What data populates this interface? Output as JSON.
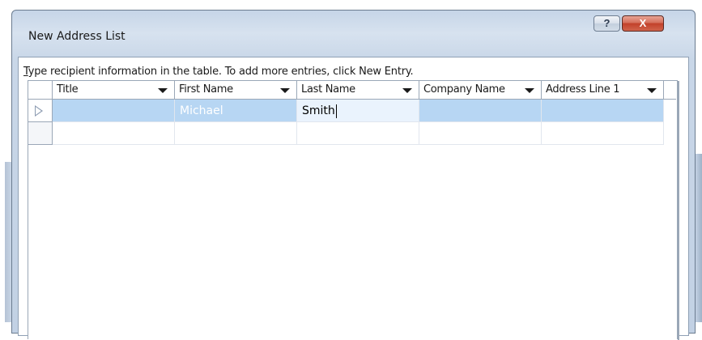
{
  "window": {
    "title": "New Address List",
    "help_label": "?",
    "close_label": "X"
  },
  "instruction": {
    "first_char": "T",
    "rest": "ype recipient information in the table.  To add more entries, click New Entry."
  },
  "columns": [
    {
      "label": "Title"
    },
    {
      "label": "First Name"
    },
    {
      "label": "Last Name"
    },
    {
      "label": "Company Name"
    },
    {
      "label": "Address Line 1"
    }
  ],
  "rows": [
    {
      "title": "",
      "first_name": "Michael",
      "last_name": "Smith",
      "company_name": "",
      "address_line_1": "",
      "selected": true,
      "editing_column": "last_name"
    },
    {
      "title": "",
      "first_name": "",
      "last_name": "",
      "company_name": "",
      "address_line_1": "",
      "selected": false
    }
  ],
  "icons": {
    "help": "help-icon",
    "close": "close-icon",
    "row_pointer": "row-pointer-icon",
    "column_dropdown": "chevron-down-icon"
  },
  "colors": {
    "selected_row": "#b7d6f3",
    "close_button": "#c2412a",
    "title_gradient": "#d7e2ef"
  }
}
